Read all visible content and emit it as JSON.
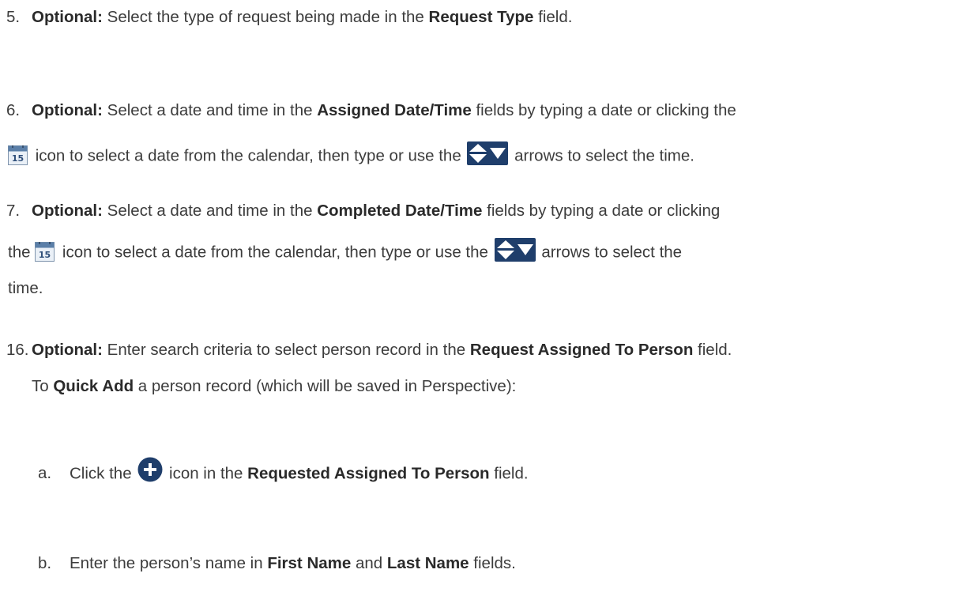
{
  "steps": {
    "s5": {
      "num": "5.",
      "t1": "Optional:",
      "t2": " Select the type of request being made in the ",
      "t3": "Request Type",
      "t4": " field."
    },
    "s6": {
      "num": "6.",
      "t1": "Optional:",
      "t2": " Select a date and time in the ",
      "t3": "Assigned Date/Time",
      "t4": " fields by typing a date or clicking the",
      "t5": " icon to select a date from the calendar, then type or use the ",
      "t6": " arrows to select the time."
    },
    "s7": {
      "num": "7.",
      "t1": "Optional:",
      "t2": " Select a date and time in the ",
      "t3": "Completed Date/Time",
      "t4": " fields by typing a date or clicking",
      "t5": "the ",
      "t6": " icon to select a date from the calendar, then type or use the ",
      "t7": " arrows to select the",
      "t8": "time."
    },
    "s16": {
      "num": "16.",
      "t1": "Optional:",
      "t2": " Enter search criteria to select person record in the ",
      "t3": "Request Assigned To Person",
      "t4": " field.",
      "t5": "To ",
      "t6": "Quick Add",
      "t7": " a person record (which will be saved in Perspective):"
    },
    "sa": {
      "num": "a.",
      "t1": "Click the ",
      "t2": " icon in the ",
      "t3": "Requested Assigned To Person",
      "t4": " field."
    },
    "sb": {
      "num": "b.",
      "t1": "Enter the person’s name in ",
      "t2": "First Name",
      "t3": " and ",
      "t4": "Last Name",
      "t5": " fields."
    }
  },
  "icons": {
    "calendar_day": "15",
    "calendar_icon": "calendar-icon",
    "time_arrows_icon": "time-spinner-arrows-icon",
    "quick_add_icon": "plus-circle-icon",
    "accent": "#1f3e6b"
  }
}
